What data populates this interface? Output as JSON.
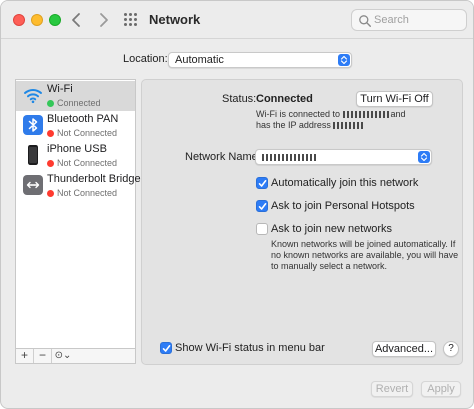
{
  "window": {
    "title": "Network"
  },
  "search": {
    "placeholder": "Search"
  },
  "location": {
    "label": "Location:",
    "value": "Automatic"
  },
  "services": [
    {
      "name": "Wi-Fi",
      "status": "Connected",
      "status_color": "#34c759",
      "icon": "wifi-icon",
      "selected": true
    },
    {
      "name": "Bluetooth PAN",
      "status": "Not Connected",
      "status_color": "#ff3b30",
      "icon": "bluetooth-icon",
      "selected": false
    },
    {
      "name": "iPhone USB",
      "status": "Not Connected",
      "status_color": "#ff3b30",
      "icon": "iphone-icon",
      "selected": false
    },
    {
      "name": "Thunderbolt Bridge",
      "status": "Not Connected",
      "status_color": "#ff3b30",
      "icon": "thunderbolt-bridge-icon",
      "selected": false
    }
  ],
  "sidebar_tools": {
    "add": "+",
    "remove": "−",
    "more": "⊙⌄"
  },
  "detail": {
    "status_label": "Status:",
    "status_value": "Connected",
    "turn_off_button": "Turn Wi-Fi Off",
    "status_desc_1": "Wi-Fi is connected to",
    "status_desc_and": "and",
    "status_desc_2": "has the IP address",
    "network_name_label": "Network Name:",
    "auto_join": {
      "label": "Automatically join this network",
      "checked": true
    },
    "personal_hotspots": {
      "label": "Ask to join Personal Hotspots",
      "checked": true
    },
    "new_networks": {
      "label": "Ask to join new networks",
      "checked": false
    },
    "new_networks_note_1": "Known networks will be joined automatically. If",
    "new_networks_note_2": "no known networks are available, you will have",
    "new_networks_note_3": "to manually select a network.",
    "show_status": {
      "label": "Show Wi-Fi status in menu bar",
      "checked": true
    },
    "advanced_button": "Advanced...",
    "help_button": "?"
  },
  "footer": {
    "revert_button": "Revert",
    "apply_button": "Apply"
  },
  "colors": {
    "accent": "#2d7cf6",
    "connected": "#34c759",
    "not_connected": "#ff3b30"
  }
}
